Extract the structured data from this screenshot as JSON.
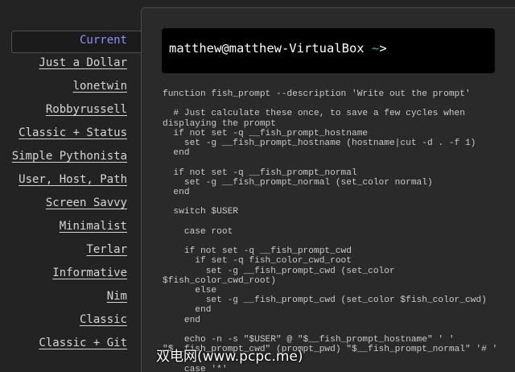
{
  "sidebar": {
    "items": [
      {
        "label": "Current",
        "active": true
      },
      {
        "label": "Just a Dollar"
      },
      {
        "label": "lonetwin"
      },
      {
        "label": "Robbyrussell"
      },
      {
        "label": "Classic + Status"
      },
      {
        "label": "Simple Pythonista"
      },
      {
        "label": "User, Host, Path"
      },
      {
        "label": "Screen Savvy"
      },
      {
        "label": "Minimalist"
      },
      {
        "label": "Terlar"
      },
      {
        "label": "Informative"
      },
      {
        "label": "Nim"
      },
      {
        "label": "Classic"
      },
      {
        "label": "Classic + Git"
      }
    ]
  },
  "preview": {
    "prompt_user": "matthew@matthew-VirtualBox",
    "prompt_cwd": " ~",
    "prompt_symbol": ">"
  },
  "code": {
    "lines": [
      "function fish_prompt --description 'Write out the prompt'",
      "",
      "  # Just calculate these once, to save a few cycles when",
      "displaying the prompt",
      "  if not set -q __fish_prompt_hostname",
      "    set -g __fish_prompt_hostname (hostname|cut -d . -f 1)",
      "  end",
      "",
      "  if not set -q __fish_prompt_normal",
      "    set -g __fish_prompt_normal (set_color normal)",
      "  end",
      "",
      "  switch $USER",
      "",
      "    case root",
      "",
      "    if not set -q __fish_prompt_cwd",
      "      if set -q fish_color_cwd_root",
      "        set -g __fish_prompt_cwd (set_color",
      "$fish_color_cwd_root)",
      "      else",
      "        set -g __fish_prompt_cwd (set_color $fish_color_cwd)",
      "      end",
      "    end",
      "",
      "    echo -n -s \"$USER\" @ \"$__fish_prompt_hostname\" ' '",
      "\"$__fish_prompt_cwd\" (prompt_pwd) \"$__fish_prompt_normal\" '# '",
      "",
      "    case '*'"
    ]
  },
  "watermark": "双电网(www.pcpc.me)"
}
